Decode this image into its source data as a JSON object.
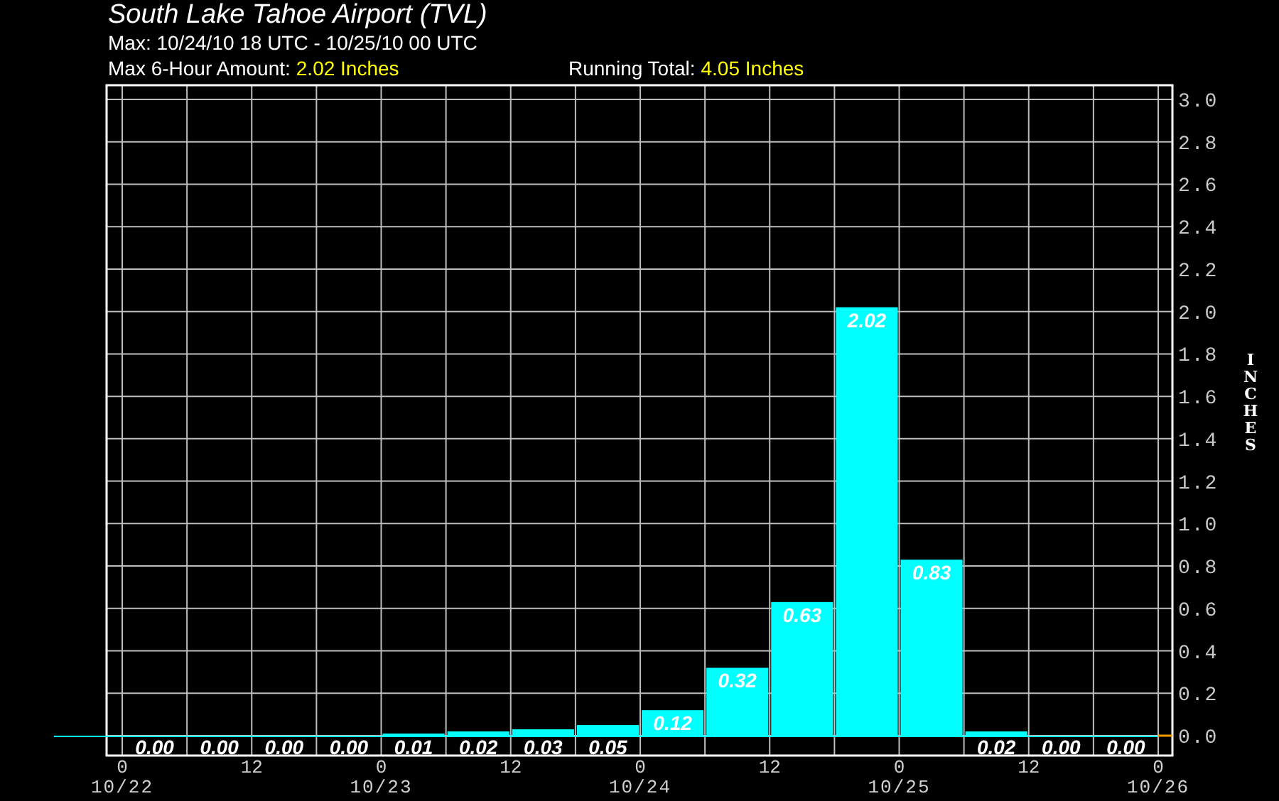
{
  "title": "South Lake Tahoe Airport (TVL)",
  "subtitle": "Max: 10/24/10 18 UTC - 10/25/10 00 UTC",
  "stats": [
    {
      "label": "Max 6-Hour Amount:",
      "value": "2.02 Inches"
    },
    {
      "label": "Running Total:",
      "value": "4.05 Inches"
    }
  ],
  "chart_data": {
    "type": "bar",
    "ylabel": "INCHES",
    "grid": true,
    "ylim": [
      0,
      3.0
    ],
    "series": [
      {
        "color": "#00ffff",
        "values": [
          0.0,
          0.0,
          0.0,
          0.0,
          0.01,
          0.02,
          0.03,
          0.05,
          0.12,
          0.32,
          0.63,
          2.02,
          0.83,
          0.02,
          0.0,
          0.0
        ]
      }
    ],
    "value_labels": [
      "0.00",
      "0.00",
      "0.00",
      "0.00",
      "0.01",
      "0.02",
      "0.03",
      "0.05",
      "0.12",
      "0.32",
      "0.63",
      "2.02",
      "0.83",
      "0.02",
      "0.00",
      "0.00"
    ],
    "yticks": [
      {
        "value": 0,
        "label": "0.0"
      },
      {
        "value": 0.2,
        "label": "0.2"
      },
      {
        "value": 0.4,
        "label": "0.4"
      },
      {
        "value": 0.6,
        "label": "0.6"
      },
      {
        "value": 0.8,
        "label": "0.8"
      },
      {
        "value": 1.0,
        "label": "1.0"
      },
      {
        "value": 1.2,
        "label": "1.2"
      },
      {
        "value": 1.4,
        "label": "1.4"
      },
      {
        "value": 1.6,
        "label": "1.6"
      },
      {
        "value": 1.8,
        "label": "1.8"
      },
      {
        "value": 2.0,
        "label": "2.0"
      },
      {
        "value": 2.2,
        "label": "2.2"
      },
      {
        "value": 2.4,
        "label": "2.4"
      },
      {
        "value": 2.6,
        "label": "2.6"
      },
      {
        "value": 2.8,
        "label": "2.8"
      },
      {
        "value": 3.0,
        "label": "3.0"
      }
    ]
  },
  "time_axis": [
    {
      "hour": "0",
      "date": "10/22"
    },
    {
      "hour": "12"
    },
    {
      "hour": "0",
      "date": "10/23"
    },
    {
      "hour": "12"
    },
    {
      "hour": "0",
      "date": "10/24"
    },
    {
      "hour": "12"
    },
    {
      "hour": "0",
      "date": "10/25"
    },
    {
      "hour": "12"
    },
    {
      "hour": "0",
      "date": "10/26"
    }
  ]
}
